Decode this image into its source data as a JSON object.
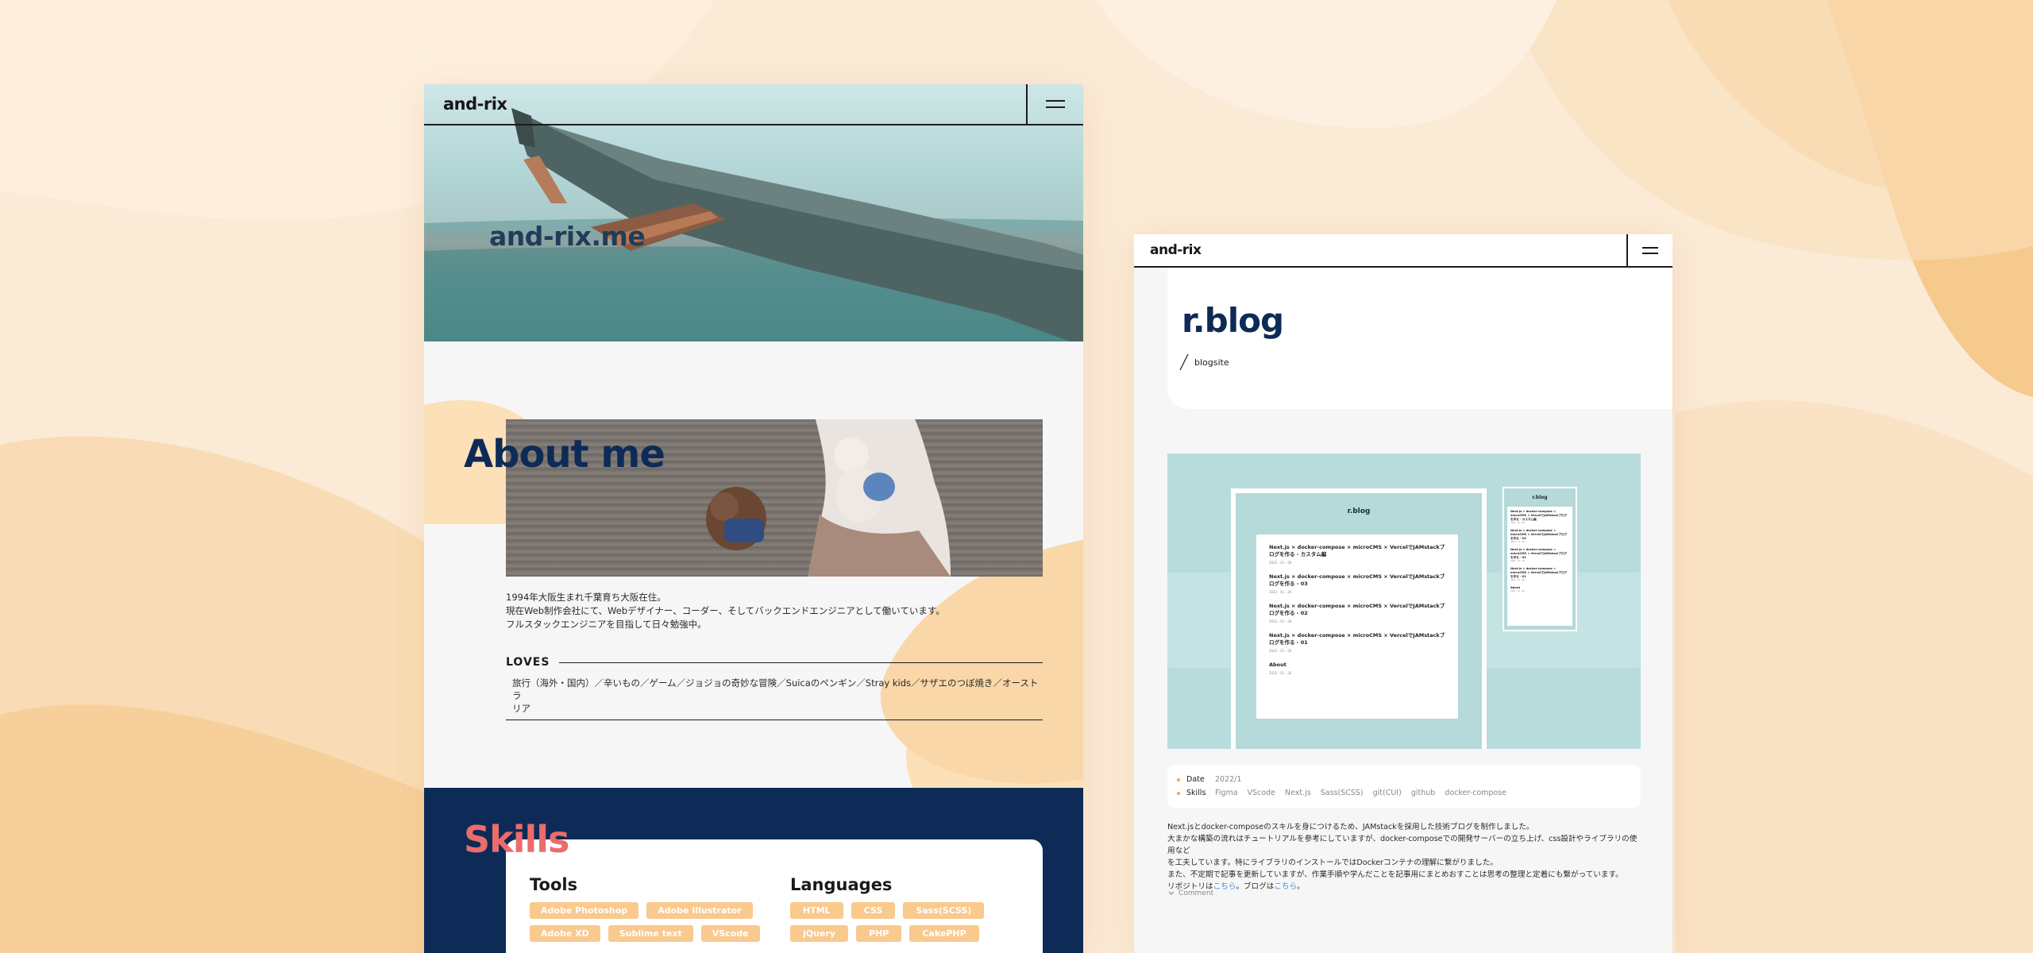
{
  "colors": {
    "background": "#fbead6",
    "navy": "#0e2b57",
    "coral": "#ec6c6c",
    "peach": "#f9c98e",
    "mint": "#b5d8d9"
  },
  "left_page": {
    "header": {
      "logo": "and-rix",
      "menu_icon": "hamburger-icon"
    },
    "hero": {
      "title": "and-rix.me"
    },
    "about": {
      "heading": "About me",
      "lines": [
        "1994年大阪生まれ千葉育ち大阪在住。",
        "現在Web制作会社にて、Webデザイナー、コーダー、そしてバックエンドエンジニアとして働いています。",
        "フルスタックエンジニアを目指して日々勉強中。"
      ],
      "loves_label": "LOVES",
      "loves_lines": [
        "旅行（海外・国内）／辛いもの／ゲーム／ジョジョの奇妙な冒険／Suicaのペンギン／Stray kids／サザエのつぼ焼き／オーストラ",
        "リア"
      ]
    },
    "skills": {
      "heading": "Skills",
      "tools": {
        "label": "Tools",
        "row1": [
          "Adobe Photoshop",
          "Adobe Illustrator"
        ],
        "row2": [
          "Adobe XD",
          "Sublime text",
          "VScode"
        ]
      },
      "languages": {
        "label": "Languages",
        "row1": [
          "HTML",
          "CSS",
          "Sass(SCSS)"
        ],
        "row2": [
          "jQuery",
          "PHP",
          "CakePHP"
        ]
      }
    }
  },
  "right_page": {
    "header": {
      "logo": "and-rix",
      "menu_icon": "hamburger-icon"
    },
    "title": "r.blog",
    "subtitle": "blogsite",
    "preview": {
      "desktop_title": "r.blog",
      "mobile_title": "r.blog",
      "desktop_posts": [
        {
          "title": "Next.js × docker-compose × microCMS × VercelでJAMstackブログを作る - カスタム編",
          "date": "2022 - 01 - 26"
        },
        {
          "title": "Next.js × docker-compose × microCMS × VercelでJAMstackブログを作る - 03",
          "date": "2022 - 01 - 26"
        },
        {
          "title": "Next.js × docker-compose × microCMS × VercelでJAMstackブログを作る - 02",
          "date": "2022 - 01 - 26"
        },
        {
          "title": "Next.js × docker-compose × microCMS × VercelでJAMstackブログを作る - 01",
          "date": "2022 - 01 - 26"
        },
        {
          "title": "About",
          "date": "2022 - 01 - 26"
        }
      ],
      "mobile_posts": [
        {
          "title": "Next.js × docker-compose × microCMS × VercelでJAMstackブログを作る - カスタム編",
          "date": "2022 - 01 - 26"
        },
        {
          "title": "Next.js × docker-compose × microCMS × VercelでJAMstackブログを作る - 03",
          "date": "2022 - 01 - 26"
        },
        {
          "title": "Next.js × docker-compose × microCMS × VercelでJAMstackブログを作る - 02",
          "date": "2022 - 01 - 26"
        },
        {
          "title": "Next.js × docker-compose × microCMS × VercelでJAMstackブログを作る - 01",
          "date": "2022 - 01 - 26"
        },
        {
          "title": "About",
          "date": "2022 - 01 - 26"
        }
      ]
    },
    "meta": {
      "date_label": "Date",
      "date_value": "2022/1",
      "skills_label": "Skills",
      "skills": [
        "Figma",
        "VScode",
        "Next.js",
        "Sass(SCSS)",
        "git(CUI)",
        "github",
        "docker-compose"
      ]
    },
    "description": {
      "line1": "Next.jsとdocker-composeのスキルを身につけるため、JAMstackを採用した技術ブログを制作しました。",
      "line2": "大まかな構築の流れはチュートリアルを参考にしていますが、docker-composeでの開発サーバーの立ち上げ、css設計やライブラリの使用など",
      "line3": "を工夫しています。特にライブラリのインストールではDockerコンテナの理解に繋がりました。",
      "line4": "また、不定期で記事を更新していますが、作業手順や学んだことを記事用にまとめおすことは思考の整理と定着にも繋がっています。",
      "line5_pre": "リポジトリは",
      "line5_link1": "こちら",
      "line5_mid": "。ブログは",
      "line5_link2": "こちら",
      "line5_end": "。"
    },
    "comment_toggle": "Comment"
  }
}
